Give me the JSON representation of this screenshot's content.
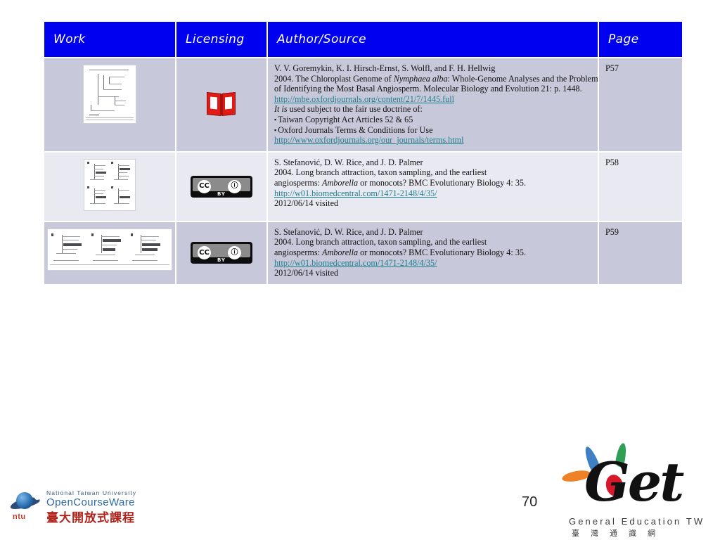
{
  "slide": {
    "number": "70"
  },
  "table": {
    "headers": {
      "work": "Work",
      "licensing": "Licensing",
      "author_source": "Author/Source",
      "page": "Page"
    },
    "rows": [
      {
        "work_icon": "phylogenetic-tree-figure-thumbnail",
        "license_icon": "red-open-book-icon",
        "license_name": "Fair Use / Copyrighted",
        "page": "P57",
        "lines": [
          {
            "type": "text",
            "text": "V. V. Goremykin, K. I. Hirsch-Ernst, S. Wolfl, and F. H. Hellwig"
          },
          {
            "type": "mixed",
            "pre": "2004. The Chloroplast Genome of ",
            "italic": "Nymphaea alba",
            "post": ": Whole-Genome Analyses and the Problem"
          },
          {
            "type": "text",
            "text": "of Identifying the Most Basal Angiosperm. Molecular Biology and Evolution 21: p. 1448."
          },
          {
            "type": "link",
            "text": "http://mbe.oxfordjournals.org/content/21/7/1445.full"
          },
          {
            "type": "mixed",
            "pre": "",
            "italic": "It is",
            "post": " used subject to the fair use doctrine of:"
          },
          {
            "type": "bullet",
            "text": "Taiwan Copyright Act Articles 52 & 65"
          },
          {
            "type": "bullet",
            "text": "Oxford Journals Terms & Conditions for Use"
          },
          {
            "type": "link",
            "text": "http://www.oxfordjournals.org/our_journals/terms.html"
          }
        ]
      },
      {
        "work_icon": "four-panel-phylogeny-figure-thumbnail",
        "license_icon": "cc-by-badge-icon",
        "license_name": "CC BY",
        "page": "P58",
        "lines": [
          {
            "type": "text",
            "text": "S. Stefanović, D. W. Rice, and J. D. Palmer"
          },
          {
            "type": "text",
            "text": "2004. Long branch attraction, taxon sampling, and the earliest"
          },
          {
            "type": "mixed",
            "pre": "angiosperms: ",
            "italic": "Amborella",
            "post": " or monocots? BMC Evolutionary Biology 4: 35."
          },
          {
            "type": "link",
            "text": "http://w01.biomedcentral.com/1471-2148/4/35/"
          },
          {
            "type": "text",
            "text": "2012/06/14 visited"
          }
        ]
      },
      {
        "work_icon": "three-panel-phylogeny-figure-thumbnail",
        "license_icon": "cc-by-badge-icon",
        "license_name": "CC BY",
        "page": "P59",
        "lines": [
          {
            "type": "text",
            "text": "S. Stefanović, D. W. Rice, and J. D. Palmer"
          },
          {
            "type": "text",
            "text": "2004. Long branch attraction, taxon sampling, and the earliest"
          },
          {
            "type": "mixed",
            "pre": "angiosperms: ",
            "italic": "Amborella",
            "post": " or monocots? BMC Evolutionary Biology 4: 35."
          },
          {
            "type": "link",
            "text": "http://w01.biomedcentral.com/1471-2148/4/35/"
          },
          {
            "type": "text",
            "text": "2012/06/14 visited"
          }
        ]
      }
    ]
  },
  "cc_badge": {
    "cc_label": "CC",
    "person_label": "ⓘ",
    "by_label": "BY"
  },
  "footer": {
    "ntu": {
      "abbr": "ntu",
      "line1": "National Taiwan University",
      "line2": "OpenCourseWare",
      "line3": "臺大開放式課程"
    },
    "get": {
      "wordmark": "Get",
      "subtitle_en": "General Education TW",
      "subtitle_zh": "臺灣通識網"
    }
  },
  "colors": {
    "header_bg": "#0000f0",
    "header_text": "#ffffff",
    "row_dark": "#c7c8da",
    "row_light": "#e9eaf1",
    "link": "#1d7f8c",
    "body_text": "#111111"
  }
}
